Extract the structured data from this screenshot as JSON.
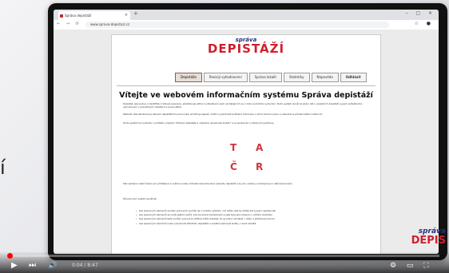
{
  "slide": {
    "partial_word": "í"
  },
  "browser": {
    "tab_title": "Správa depistáží",
    "tab_close": "×",
    "new_tab": "+",
    "window_controls": "– ▢ ×",
    "nav_buttons": "← → ⟳",
    "url": "www.sprava-depistazi.cz",
    "addr_right": "☆ ●"
  },
  "site": {
    "logo_small": "správa",
    "logo_big": "DEPISTÁŽÍ",
    "menu": [
      {
        "label": "Depistáže"
      },
      {
        "label": "Reviziji vyhodnocení"
      },
      {
        "label": "Správa lokalit"
      },
      {
        "label": "Statistiky"
      },
      {
        "label": "Nápověda"
      },
      {
        "label": "Odhlásit"
      }
    ],
    "heading": "Vítejte ve webovém informačním systému Správa depistáží",
    "paragraphs": [
      "Depistáž, jako pokus o identifikaci rizikové populace, představuje aktivní vyhledávání osob nacházejících se v riziku sociálního vyloučení. Tento systém slouží ke sběru dat o výsledcích depistáží a jejich průběžnému vyhodnocení v jednotlivých lokalitách a pracovištích.",
      "Základní standardizovaný záznam depistážního pracovníka umožňuje zapsat, uložit a vyhodnotit potřebné informace v rámci terénní práce a následně je předat dalším institucím.",
      "Tento systém byl vytvořen v průběhu projektu \"Posílení depistáže a následné návaznosti služeb\" a ve spolupráci s odbornými partnery."
    ],
    "big_letters": [
      "T",
      "A",
      "Č",
      "R"
    ],
    "paragraph_after": "Tato aplikace nabízí řešení pro přihlášené a ověřené osoby. Uživatel zaznamenává výsledky depistáží a ty jsou uloženy a dostupné pro další zpracování.",
    "list_intro": "Důvody proč systém používat:",
    "list": [
      "bez písemných záznamů sociální pracovník vychází jen z ústního předání, což může vést ke ztrátě dat a jejich nepřesnosti",
      "bez písemných záznamů se nedá zpětně ověřit, zda byl klient kontaktován a jaká byla jeho situace v určitém okamžiku",
      "bez písemných záznamů také sociální pracovník obtížně může dokázat, že se klient nacházel v riziku a potřeboval pomoc",
      "bez písemných záznamů nelze vyhodnotit efektivitu depistáže a kvalitně plánovat služby v dané lokalitě"
    ]
  },
  "player": {
    "progress": 0.0,
    "play": "▶",
    "next": "⏭",
    "volume": "🔊",
    "time": "0:04 / 8:47",
    "settings_icons": "⚙ ▭ ⛶"
  },
  "watermark": {
    "small": "správa",
    "big": "DEPIS"
  }
}
